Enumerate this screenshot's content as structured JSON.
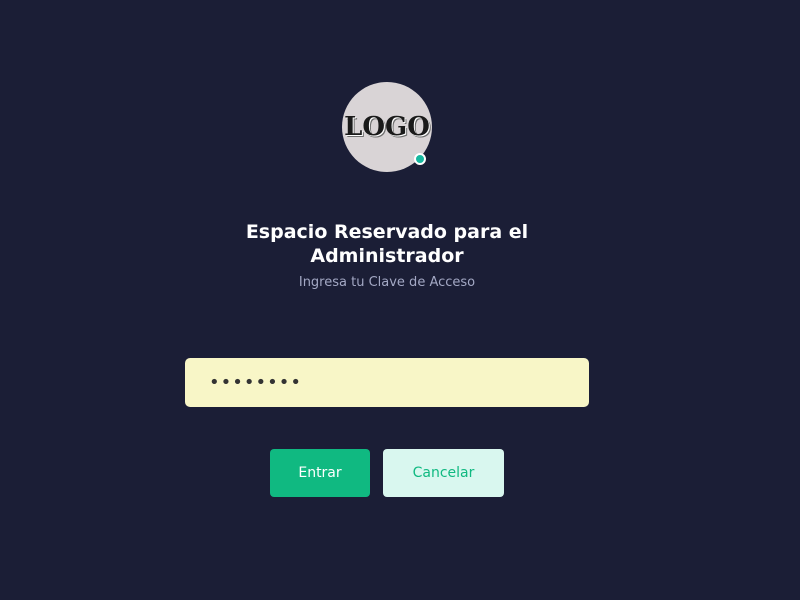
{
  "logo": {
    "text": "LOGO",
    "status_color": "#17b8a0"
  },
  "header": {
    "title": "Espacio Reservado para el Administrador",
    "subtitle": "Ingresa tu Clave de Acceso"
  },
  "form": {
    "password_value": "••••••••",
    "entrar_label": "Entrar",
    "cancelar_label": "Cancelar"
  },
  "colors": {
    "background": "#1b1e36",
    "accent": "#10b981",
    "input_bg": "#f8f6c7",
    "secondary_button_bg": "#d9f7ef"
  }
}
